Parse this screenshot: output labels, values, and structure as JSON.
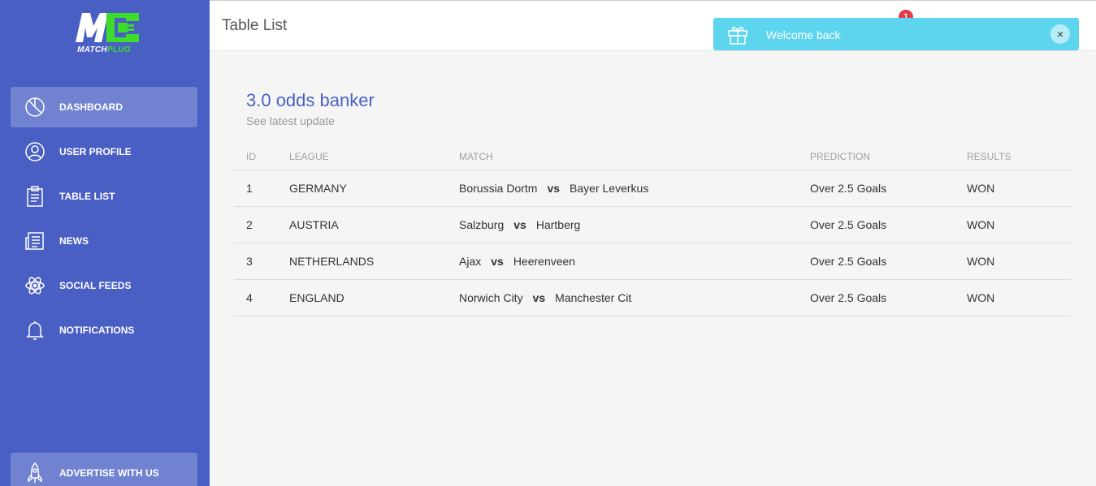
{
  "brand": {
    "logo_main": "MATCH",
    "logo_accent": "PLUG"
  },
  "sidebar": {
    "items": [
      {
        "label": "DASHBOARD",
        "icon": "pie-chart-icon",
        "active": true
      },
      {
        "label": "USER PROFILE",
        "icon": "user-icon",
        "active": false
      },
      {
        "label": "TABLE LIST",
        "icon": "clipboard-icon",
        "active": false
      },
      {
        "label": "NEWS",
        "icon": "newspaper-icon",
        "active": false
      },
      {
        "label": "SOCIAL FEEDS",
        "icon": "atom-icon",
        "active": false
      },
      {
        "label": "NOTIFICATIONS",
        "icon": "bell-icon",
        "active": false
      }
    ],
    "advertise": {
      "label": "ADVERTISE WITH US",
      "icon": "rocket-icon"
    }
  },
  "header": {
    "title": "Table List",
    "notification_count": "1"
  },
  "toast": {
    "message": "Welcome back",
    "icon": "gift-icon",
    "close": "×"
  },
  "card": {
    "title": "3.0 odds banker",
    "subtitle": "See latest update",
    "columns": [
      "ID",
      "LEAGUE",
      "MATCH",
      "PREDICTION",
      "RESULTS"
    ],
    "rows": [
      {
        "id": "1",
        "league": "GERMANY",
        "home": "Borussia Dortm",
        "vs": "vs",
        "away": "Bayer Leverkus",
        "prediction": "Over 2.5 Goals",
        "result": "WON"
      },
      {
        "id": "2",
        "league": "AUSTRIA",
        "home": "Salzburg",
        "vs": "vs",
        "away": "Hartberg",
        "prediction": "Over 2.5 Goals",
        "result": "WON"
      },
      {
        "id": "3",
        "league": "NETHERLANDS",
        "home": "Ajax",
        "vs": "vs",
        "away": "Heerenveen",
        "prediction": "Over 2.5 Goals",
        "result": "WON"
      },
      {
        "id": "4",
        "league": "ENGLAND",
        "home": "Norwich City",
        "vs": "vs",
        "away": "Manchester Cit",
        "prediction": "Over 2.5 Goals",
        "result": "WON"
      }
    ]
  },
  "colors": {
    "sidebar": "#4a5fc4",
    "accent": "#4a5fc4",
    "logo_green": "#3ddc2b",
    "toast": "#5ed5ee",
    "badge": "#e53948"
  }
}
